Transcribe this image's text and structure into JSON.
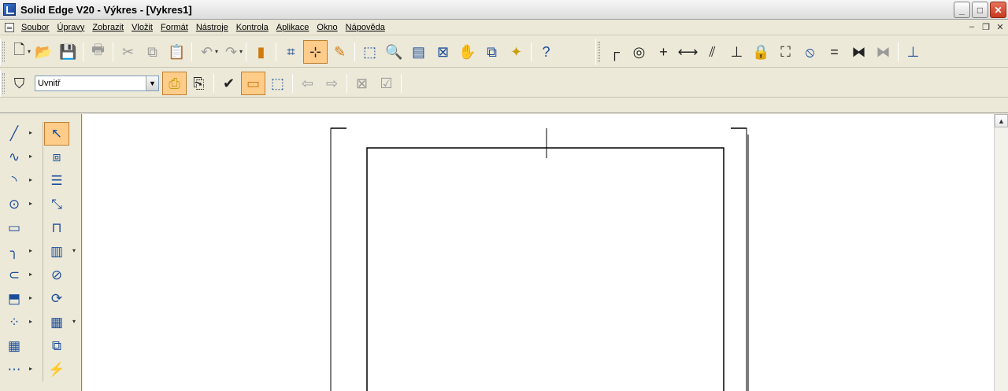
{
  "window": {
    "title": "Solid Edge V20 - Výkres - [Vykres1]",
    "controls": {
      "minimize": "_",
      "maximize": "□",
      "close": "✕"
    }
  },
  "menubar": {
    "items": [
      "Soubor",
      "Úpravy",
      "Zobrazit",
      "Vložit",
      "Formát",
      "Nástroje",
      "Kontrola",
      "Aplikace",
      "Okno",
      "Nápověda"
    ],
    "mdi_controls": {
      "minimize": "–",
      "restore": "❐",
      "close": "✕"
    }
  },
  "toolbar2": {
    "filter_select": {
      "value": "Uvnitř"
    }
  },
  "colors": {
    "accent_active": "#ffcc8a",
    "toolbar_bg": "#ece9d8",
    "icon_blue": "#1b4c9a"
  }
}
